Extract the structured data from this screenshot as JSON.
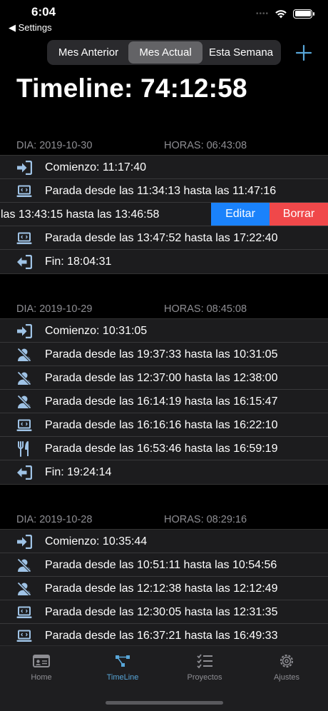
{
  "status_bar": {
    "time": "6:04",
    "back_label": "◀ Settings"
  },
  "segmented": {
    "options": [
      "Mes Anterior",
      "Mes Actual",
      "Esta Semana"
    ],
    "selected": "Mes Actual"
  },
  "title": "Timeline: 74:12:58",
  "colors": {
    "accent": "#58a6d8",
    "edit": "#1a82fb",
    "delete": "#f0484a",
    "icon": "#9fc3e6"
  },
  "sections": [
    {
      "dia": "DIA: 2019-10-30",
      "horas": "HORAS: 06:43:08",
      "rows": [
        {
          "icon": "login-icon",
          "text": "Comienzo: 11:17:40"
        },
        {
          "icon": "laptop-icon",
          "text": "Parada desde las 11:34:13 hasta las 11:47:16"
        },
        {
          "icon": "laptop-icon",
          "text": "las 13:43:15 hasta las 13:46:58",
          "swiped": true
        },
        {
          "icon": "laptop-icon",
          "text": "Parada desde las 13:47:52 hasta las 17:22:40"
        },
        {
          "icon": "logout-icon",
          "text": "Fin: 18:04:31"
        }
      ]
    },
    {
      "dia": "DIA: 2019-10-29",
      "horas": "HORAS: 08:45:08",
      "rows": [
        {
          "icon": "login-icon",
          "text": "Comienzo: 10:31:05"
        },
        {
          "icon": "person-off-icon",
          "text": "Parada desde las 19:37:33 hasta las 10:31:05"
        },
        {
          "icon": "person-off-icon",
          "text": "Parada desde las 12:37:00 hasta las 12:38:00"
        },
        {
          "icon": "person-off-icon",
          "text": "Parada desde las 16:14:19 hasta las 16:15:47"
        },
        {
          "icon": "laptop-icon",
          "text": "Parada desde las 16:16:16 hasta las 16:22:10"
        },
        {
          "icon": "fork-knife-icon",
          "text": "Parada desde las 16:53:46 hasta las 16:59:19"
        },
        {
          "icon": "logout-icon",
          "text": "Fin: 19:24:14"
        }
      ]
    },
    {
      "dia": "DIA: 2019-10-28",
      "horas": "HORAS: 08:29:16",
      "rows": [
        {
          "icon": "login-icon",
          "text": "Comienzo: 10:35:44"
        },
        {
          "icon": "person-off-icon",
          "text": "Parada desde las 10:51:11 hasta las 10:54:56"
        },
        {
          "icon": "person-off-icon",
          "text": "Parada desde las 12:12:38 hasta las 12:12:49"
        },
        {
          "icon": "laptop-icon",
          "text": "Parada desde las 12:30:05 hasta las 12:31:35"
        },
        {
          "icon": "laptop-icon",
          "text": "Parada desde las 16:37:21 hasta las 16:49:33"
        }
      ]
    }
  ],
  "swipe_actions": {
    "edit": "Editar",
    "delete": "Borrar"
  },
  "tabs": [
    {
      "label": "Home",
      "icon": "id-card-icon"
    },
    {
      "label": "TimeLine",
      "icon": "timeline-icon",
      "active": true
    },
    {
      "label": "Proyectos",
      "icon": "checklist-icon"
    },
    {
      "label": "Ajustes",
      "icon": "gear-icon"
    }
  ]
}
